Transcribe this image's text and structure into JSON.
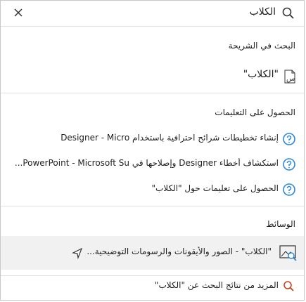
{
  "search": {
    "value": "الكلاب"
  },
  "sections": {
    "slide": {
      "header": "البحث في الشريحة",
      "item": "\"الكلاب\""
    },
    "help": {
      "header": "الحصول على التعليمات",
      "items": [
        "إنشاء تخطيطات شرائح احترافية باستخدام Designer - Micro",
        "استكشاف أخطاء Designer وإصلاحها في PowerPoint - Microsoft Su...",
        "الحصول على تعليمات حول \"الكلاب\""
      ]
    },
    "media": {
      "header": "الوسائط",
      "item": "\"الكلاب\" - الصور والأيقونات والرسومات التوضيحية..."
    },
    "more": {
      "label": "المزيد من نتائج البحث عن \"الكلاب\""
    }
  },
  "colors": {
    "accent": "#2b88d8",
    "link_accent": "#c43e1c"
  }
}
